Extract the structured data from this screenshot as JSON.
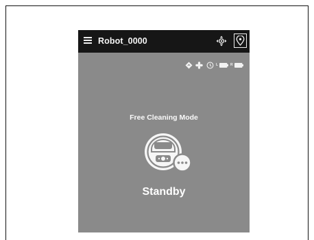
{
  "app": {
    "title": "Robot_0000"
  },
  "toolbar": {
    "icons": [
      "menu-icon",
      "move-control-icon",
      "location-pin-icon"
    ]
  },
  "status": {
    "icons": [
      "navigation-icon",
      "fan-icon",
      "timer-icon",
      "battery-left-icon",
      "battery-right-icon"
    ],
    "left_label": "L",
    "right_label": "R"
  },
  "main": {
    "mode": "Free Cleaning Mode",
    "state": "Standby"
  },
  "colors": {
    "topbar": "#161616",
    "screen": "#8a8a8a",
    "text": "#ffffff"
  }
}
